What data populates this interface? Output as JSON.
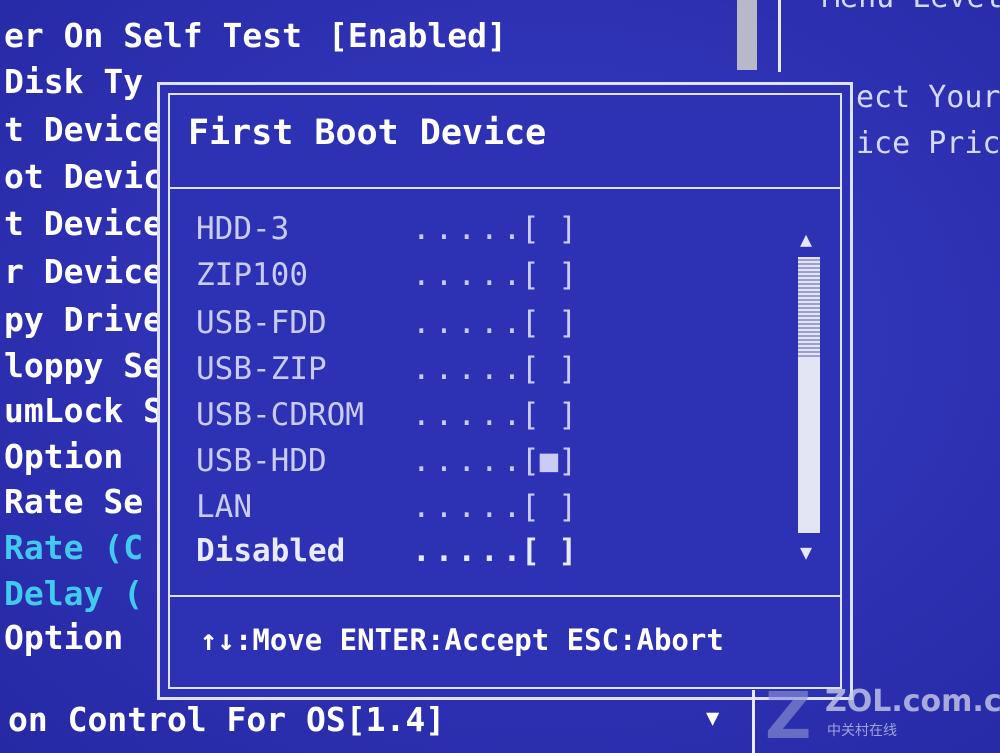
{
  "left_settings": [
    {
      "label": "er On Self Test",
      "value": "[Enabled]"
    },
    {
      "label": " Disk Ty"
    },
    {
      "label": "t Device"
    },
    {
      "label": "ot Devic"
    },
    {
      "label": "t Device"
    },
    {
      "label": "r Device"
    },
    {
      "label": "py Drive"
    },
    {
      "label": "loppy Se"
    },
    {
      "label": "umLock S"
    },
    {
      "label": "Option"
    },
    {
      "label": " Rate Se"
    },
    {
      "label": " Rate (C"
    },
    {
      "label": " Delay ("
    },
    {
      "label": "Option"
    }
  ],
  "help_panel": {
    "top_line": "Menu Level",
    "line1": "ect Your",
    "line2": "ice Pric"
  },
  "popup": {
    "title": "First Boot Device",
    "options": [
      {
        "name": "HDD-3",
        "dots": ".....",
        "box": "[ ]",
        "selected": false
      },
      {
        "name": "ZIP100",
        "dots": ".....",
        "box": "[ ]",
        "selected": false
      },
      {
        "name": "USB-FDD",
        "dots": ".....",
        "box": "[ ]",
        "selected": false
      },
      {
        "name": "USB-ZIP",
        "dots": ".....",
        "box": "[ ]",
        "selected": false
      },
      {
        "name": "USB-CDROM",
        "dots": ".....",
        "box": "[ ]",
        "selected": false
      },
      {
        "name": "USB-HDD",
        "dots": ".....",
        "box": "[■]",
        "selected": true
      },
      {
        "name": "LAN",
        "dots": ".....",
        "box": "[ ]",
        "selected": false
      },
      {
        "name": "Disabled",
        "dots": ".....",
        "box": "[ ]",
        "selected": false
      }
    ],
    "footer": "↑↓:Move ENTER:Accept ESC:Abort",
    "scroll_up": "▲",
    "scroll_down": "▼"
  },
  "bottom": {
    "line": "on Control For OS[1.4]",
    "arrow": "▼"
  },
  "watermark": {
    "logo": "Z",
    "text": "ZOL.com.cn",
    "sub": "中关村在线"
  },
  "colors": {
    "background": "#2f33b6",
    "text": "#ffffff",
    "dim_text": "#43c9ef",
    "option_text": "#c9ccf5",
    "border": "#dfe2ff"
  }
}
